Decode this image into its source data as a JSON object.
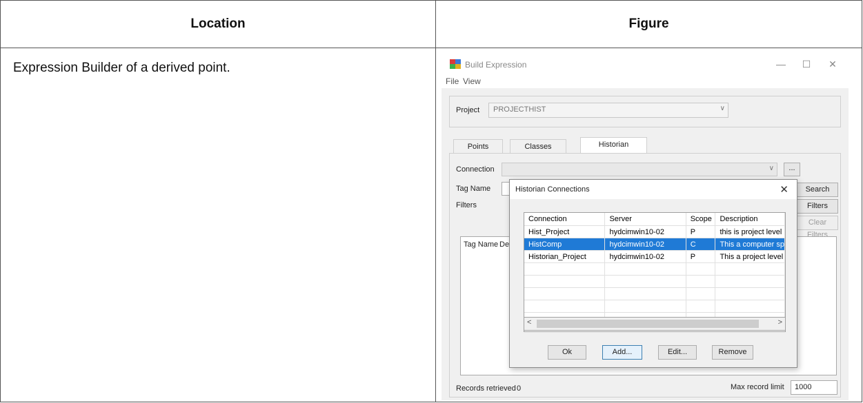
{
  "doc": {
    "col_location": "Location",
    "col_figure": "Figure",
    "location_text": "Expression Builder of a derived point."
  },
  "window": {
    "title": "Build Expression",
    "menu": [
      "File",
      "View"
    ],
    "project_label": "Project",
    "project_value": "PROJECTHIST",
    "tabs": [
      "Points",
      "Classes",
      "Historian"
    ],
    "active_tab": "Historian",
    "connection_label": "Connection",
    "connection_value": "",
    "browse_button": "...",
    "tag_name_label": "Tag Name",
    "filters_label": "Filters",
    "search_button": "Search",
    "filters_button": "Filters",
    "clear_filters_button": "Clear Filters",
    "list_columns": [
      "Tag Name",
      "Des"
    ],
    "records_retrieved_label": "Records retrieved",
    "records_retrieved_value": "0",
    "max_record_limit_label": "Max record limit",
    "max_record_limit_value": "1000"
  },
  "dialog": {
    "title": "Historian Connections",
    "columns": [
      "Connection",
      "Server",
      "Scope",
      "Description"
    ],
    "rows": [
      {
        "connection": "Hist_Project",
        "server": "hydcimwin10-02",
        "scope": "P",
        "description": "this is project level"
      },
      {
        "connection": "HistComp",
        "server": "hydcimwin10-02",
        "scope": "C",
        "description": "This a computer sp"
      },
      {
        "connection": "Historian_Project",
        "server": "hydcimwin10-02",
        "scope": "P",
        "description": "This a project level"
      }
    ],
    "selected_row": 1,
    "buttons": {
      "ok": "Ok",
      "add": "Add...",
      "edit": "Edit...",
      "remove": "Remove"
    }
  },
  "colors": {
    "selection": "#1f7ad6",
    "window_bg": "#f0f0f0"
  }
}
